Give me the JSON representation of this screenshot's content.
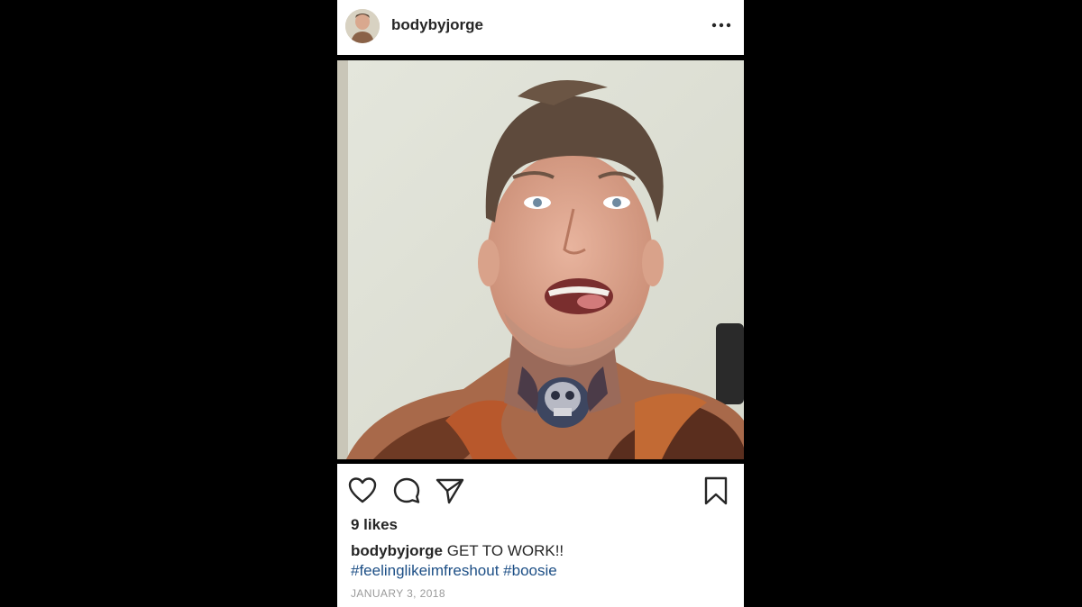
{
  "post": {
    "username": "bodybyjorge",
    "avatar": "profile-photo",
    "more_icon": "more-horizontal-icon",
    "photo": "selfie-man-tattooed-neck",
    "actions": {
      "like_icon": "heart-icon",
      "comment_icon": "comment-icon",
      "share_icon": "paper-plane-icon",
      "save_icon": "bookmark-icon"
    },
    "likes": "9 likes",
    "caption": {
      "username": "bodybyjorge",
      "text": "GET TO WORK!!",
      "hashtags": [
        "#feelinglikeimfreshout",
        "#boosie"
      ]
    },
    "date": "JANUARY 3, 2018"
  },
  "colors": {
    "background": "#000000",
    "card": "#ffffff",
    "text": "#262626",
    "hashtag": "#1d4f86",
    "date": "#9a9a9a"
  }
}
